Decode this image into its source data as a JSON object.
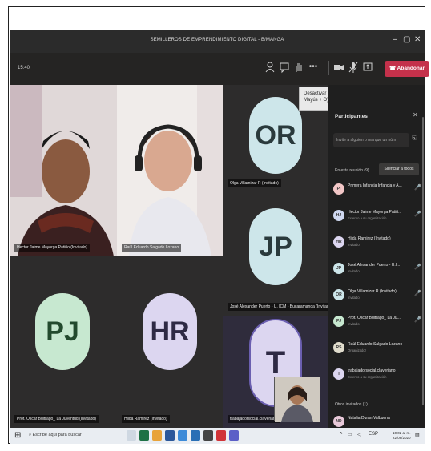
{
  "window": {
    "title": "SEMILLEROS DE EMPRENDIMIENTO DIGITAL - B/MANGA",
    "minimize": "–",
    "maximize": "▢",
    "close": "✕"
  },
  "toolbar": {
    "timer": "15:40",
    "leave_label": "Abandonar",
    "tooltip": "Desactivar cámara (Ctrl + Mayús + O)",
    "icons": [
      "participants-icon",
      "chat-icon",
      "raise-hand-icon",
      "more-icon",
      "camera-icon",
      "mic-icon",
      "share-icon"
    ]
  },
  "tiles": [
    {
      "name": "Hector Jaime Mayorga Patiño (Invitado)",
      "kind": "video"
    },
    {
      "name": "Raúl Eduardo Salgado Lozano",
      "kind": "video"
    },
    {
      "name": "Olga Villamizar R (Invitado)",
      "initials": "OR",
      "kind": "avatar"
    },
    {
      "name": "José Alexander Puerto - U. ICM - Bucaramanga (Invitado)",
      "initials": "JP",
      "kind": "avatar"
    },
    {
      "name": "Prof. Oscar Buitrago_ La Juventud (Invitado)",
      "initials": "PJ",
      "kind": "avatar"
    },
    {
      "name": "Hilda Ramirez (Invitado)",
      "initials": "HR",
      "kind": "avatar"
    },
    {
      "name": "trabajadorsocial.claveriano",
      "initials": "T",
      "kind": "avatar"
    }
  ],
  "panel": {
    "title": "Participantes",
    "invite_placeholder": "Invite a alguien o marque un núm",
    "in_meeting": "En esta reunión (9)",
    "mute_all": "Silenciar a todos",
    "others": "Otros invitados (1)",
    "participants": [
      {
        "name": "Primera Infancia Infancia y A...",
        "sub": ""
      },
      {
        "name": "Hector Jaime Mayorga Patiñ...",
        "sub": "Externo a su organización"
      },
      {
        "name": "Hilda Ramirez (Invitado)",
        "sub": "Invitado"
      },
      {
        "name": "José Alexander Puerto - U.I...",
        "sub": "Invitado"
      },
      {
        "name": "Olga Villamizar R (Invitado)",
        "sub": "Invitado"
      },
      {
        "name": "Prof. Oscar Buitrago_ La Ju...",
        "sub": "Invitado"
      },
      {
        "name": "Raúl Eduardo Salgado Lozano",
        "sub": "Organizador"
      },
      {
        "name": "trabajadorsocial.claveriano",
        "sub": "Externo a su organización"
      }
    ],
    "other_participant": "Natalia Duran Valbuena"
  },
  "taskbar": {
    "search_placeholder": "Escribe aquí para buscar",
    "time": "10:02 a. m.",
    "date": "22/09/2020",
    "lang": "ESP"
  },
  "colors": {
    "leave": "#c4314b",
    "avatar_green": "#c7e8d0",
    "avatar_lilac": "#dcd6f0",
    "avatar_teal": "#cde6ea"
  }
}
